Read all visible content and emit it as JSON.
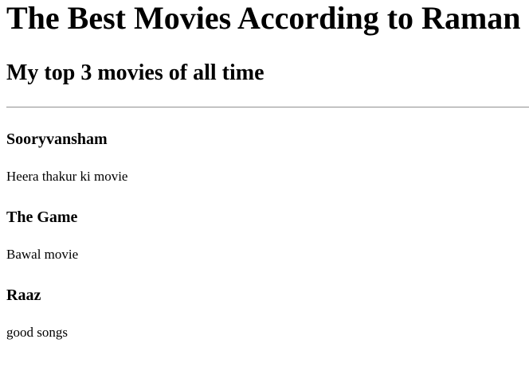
{
  "header": {
    "title": "The Best Movies According to Raman",
    "subtitle": "My top 3 movies of all time"
  },
  "movies": [
    {
      "title": "Sooryvansham",
      "description": "Heera thakur ki movie"
    },
    {
      "title": "The Game",
      "description": "Bawal movie"
    },
    {
      "title": "Raaz",
      "description": "good songs"
    }
  ]
}
